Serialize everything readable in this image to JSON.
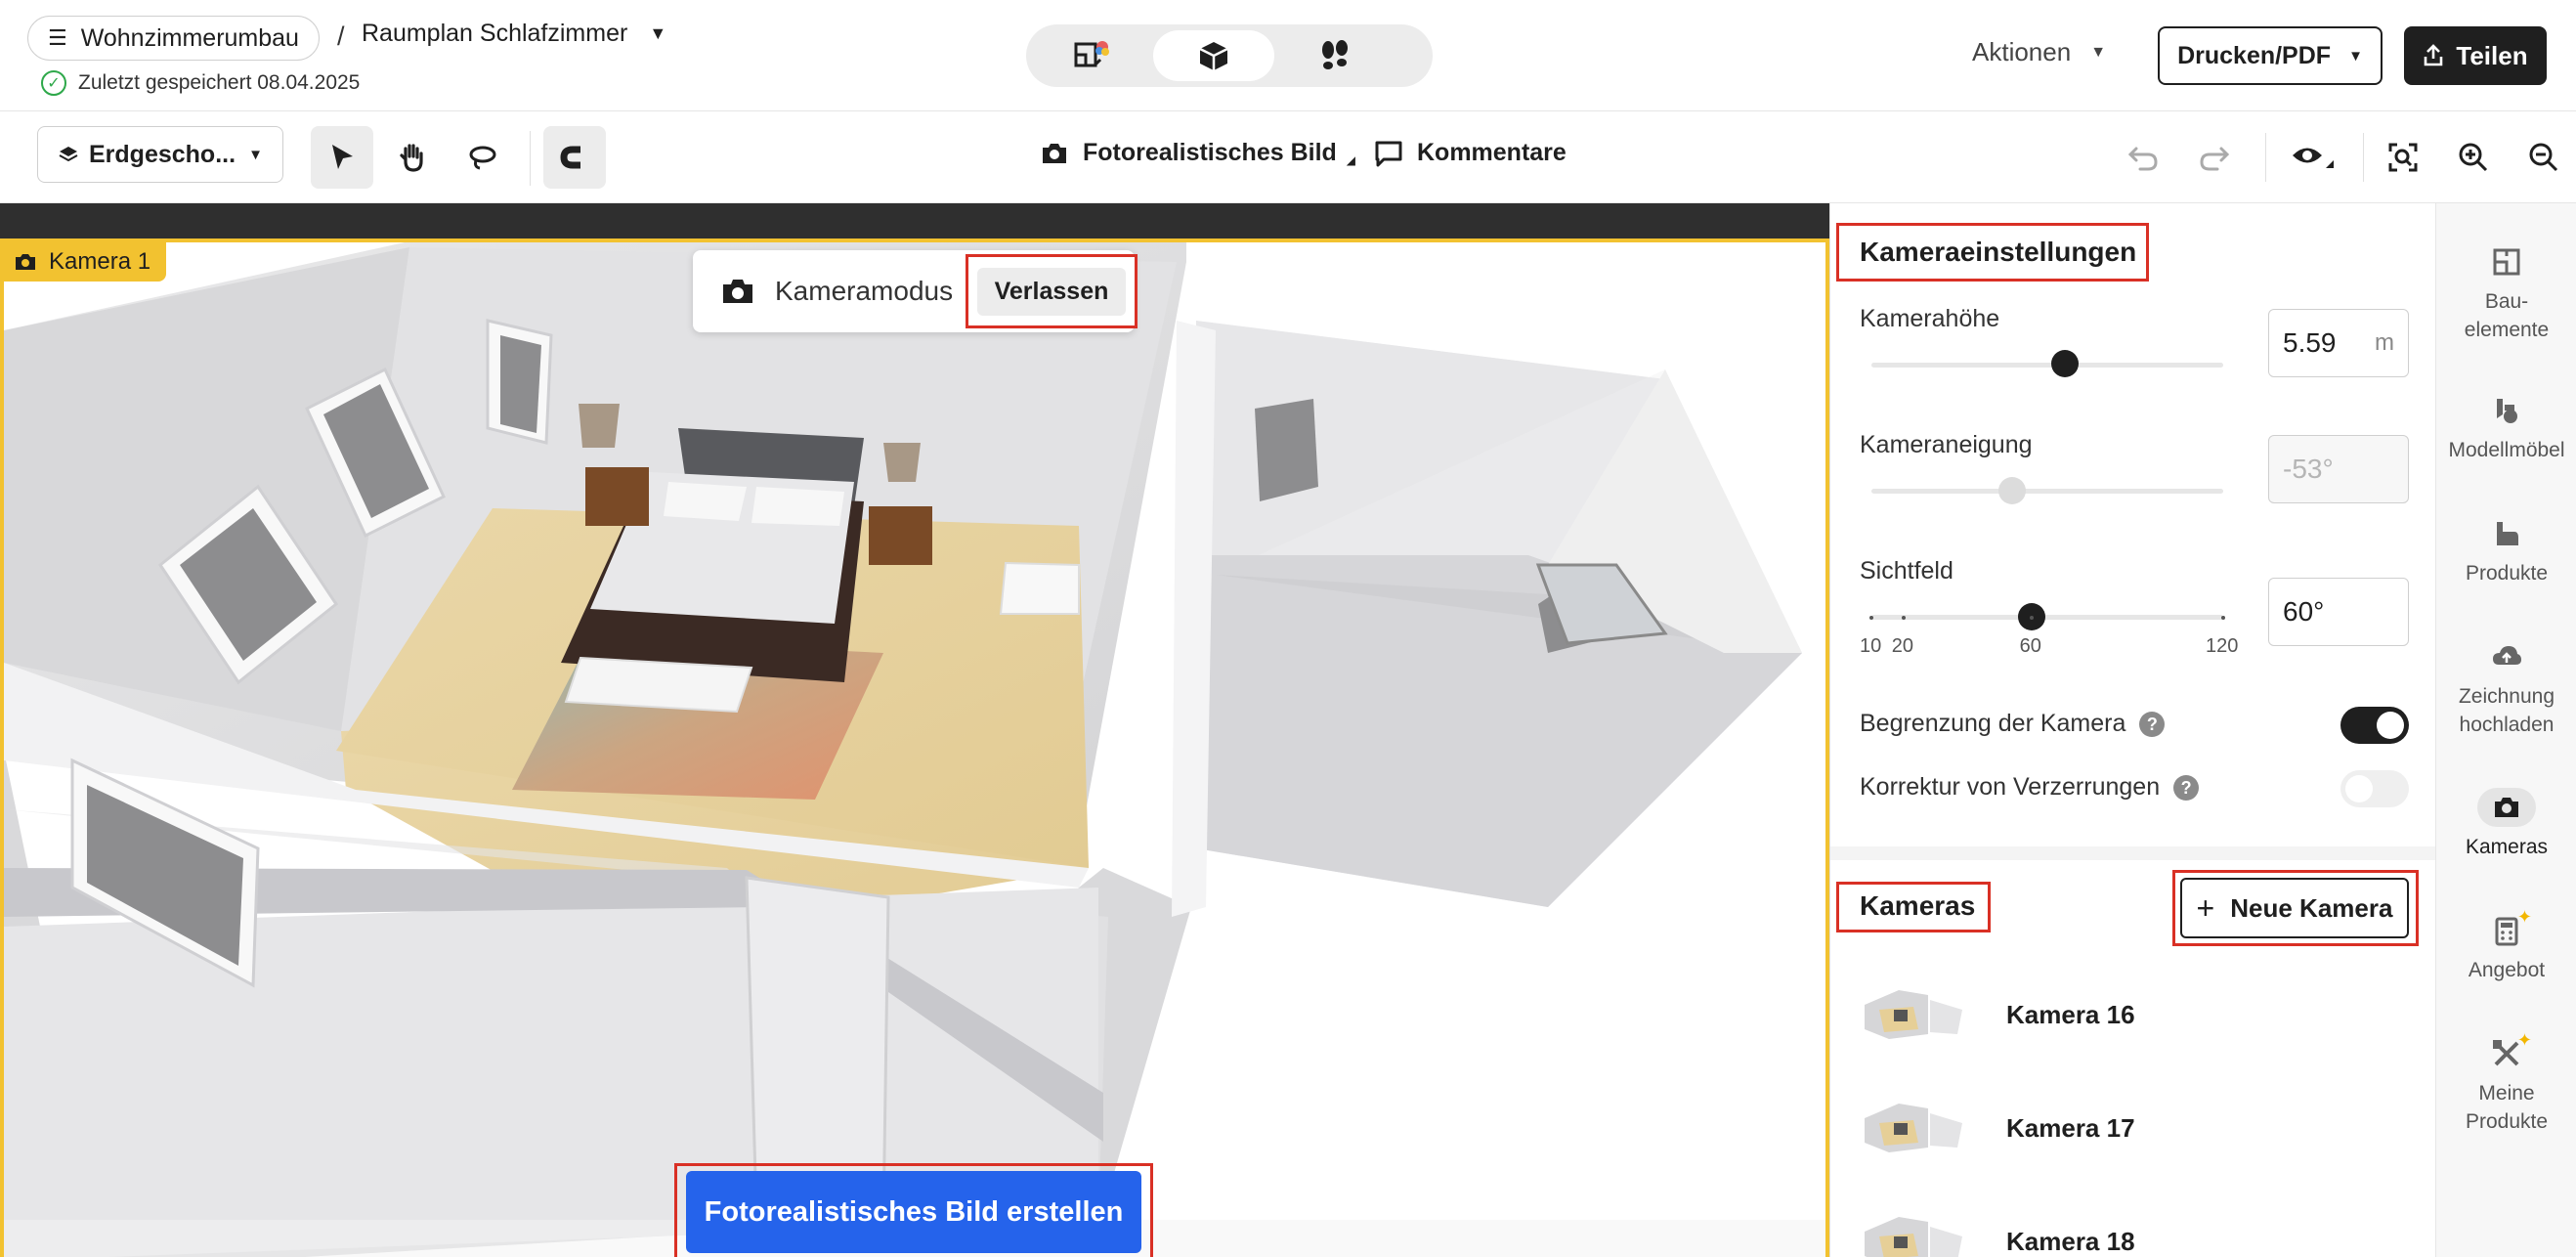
{
  "header": {
    "project": "Wohnzimmerumbau",
    "separator": "/",
    "page": "Raumplan Schlafzimmer",
    "saved_status": "Zuletzt gespeichert 08.04.2025",
    "actions_label": "Aktionen",
    "print_label": "Drucken/PDF",
    "share_label": "Teilen",
    "view_modes": [
      "2d-plan-icon",
      "3d-box-icon",
      "walkthrough-feet-icon"
    ],
    "active_view_mode": "3d-box-icon"
  },
  "toolbar": {
    "floor": "Erdgescho...",
    "tools": [
      "select-arrow-icon",
      "pan-hand-icon",
      "lasso-icon",
      "magnet-snap-icon"
    ],
    "photo_mode_label": "Fotorealistisches Bild",
    "comments_label": "Kommentare",
    "right_icons": [
      "undo-icon",
      "redo-icon",
      "visibility-eye-icon",
      "fit-screen-icon",
      "zoom-in-icon",
      "zoom-out-icon"
    ]
  },
  "viewport": {
    "camera_tag": "Kamera 1",
    "camera_mode_label": "Kameramodus",
    "exit_label": "Verlassen",
    "render_button": "Fotorealistisches Bild erstellen",
    "accent_color": "#f2c230"
  },
  "camera_settings": {
    "title": "Kameraeinstellungen",
    "height_label": "Kamerahöhe",
    "height_value": "5.59",
    "height_unit": "m",
    "height_slider": 0.55,
    "tilt_label": "Kameraneigung",
    "tilt_value": "-53°",
    "tilt_slider": 0.4,
    "fov_label": "Sichtfeld",
    "fov_value": "60°",
    "fov_ticks": [
      "10",
      "20",
      "60",
      "120"
    ],
    "fov_min": 10,
    "fov_max": 120,
    "fov": 60,
    "limit_label": "Begrenzung der Kamera",
    "limit_on": true,
    "distortion_label": "Korrektur von Verzerrungen",
    "distortion_on": false
  },
  "cameras": {
    "title": "Kameras",
    "new_label": "Neue Kamera",
    "items": [
      "Kamera 16",
      "Kamera 17",
      "Kamera 18"
    ]
  },
  "rail": {
    "items": [
      {
        "icon": "building-elements-icon",
        "label": "Bau-\nelemente"
      },
      {
        "icon": "model-furniture-icon",
        "label": "Modellmöbel"
      },
      {
        "icon": "products-icon",
        "label": "Produkte"
      },
      {
        "icon": "upload-cloud-icon",
        "label": "Zeichnung\nhochladen"
      },
      {
        "icon": "camera-icon",
        "label": "Kameras"
      },
      {
        "icon": "calculator-icon",
        "label": "Angebot"
      },
      {
        "icon": "my-products-icon",
        "label": "Meine\nProdukte"
      }
    ],
    "active": "Kameras"
  }
}
